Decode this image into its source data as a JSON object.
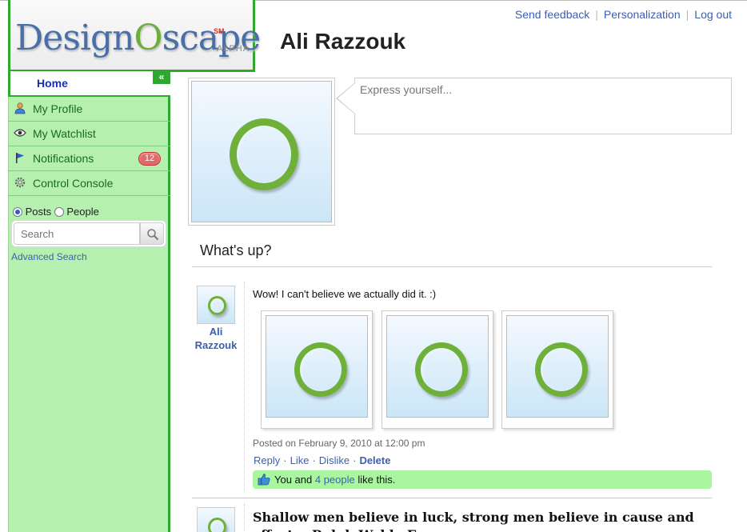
{
  "logo": {
    "text_a": "Design",
    "text_o": "O",
    "text_b": "scape",
    "sm": "SM",
    "tag": "ALPHA"
  },
  "header": {
    "links": [
      "Send feedback",
      "Personalization",
      "Log out"
    ],
    "user_name": "Ali Razzouk"
  },
  "sidebar": {
    "home_label": "Home",
    "collapse_label": "«",
    "items": [
      {
        "label": "My Profile",
        "icon": "person-icon"
      },
      {
        "label": "My Watchlist",
        "icon": "eye-icon"
      },
      {
        "label": "Notifications",
        "icon": "flag-icon",
        "badge": "12"
      },
      {
        "label": "Control Console",
        "icon": "gear-icon"
      }
    ],
    "search": {
      "option_posts": "Posts",
      "option_people": "People",
      "selected": "Posts",
      "placeholder": "Search",
      "advanced_label": "Advanced Search"
    }
  },
  "composer": {
    "placeholder": "Express yourself..."
  },
  "feed": {
    "heading": "What's up?",
    "posts": [
      {
        "author": "Ali Razzouk",
        "text": "Wow! I can't believe we actually did it. :)",
        "meta": "Posted on February 9, 2010 at 12:00 pm",
        "actions": [
          "Reply",
          "Like",
          "Dislike",
          "Delete"
        ],
        "likes_prefix": "You and ",
        "likes_link": "4 people",
        "likes_suffix": " like this."
      },
      {
        "text": "Shallow men believe in luck, strong men believe in cause and effect. - Ralph Waldo Emerson"
      }
    ]
  },
  "colors": {
    "brand_green": "#2fa82f",
    "sidebar_bg": "#b5f0b0",
    "link_blue": "#3d5fb0",
    "likes_bg": "#aaf59f"
  }
}
